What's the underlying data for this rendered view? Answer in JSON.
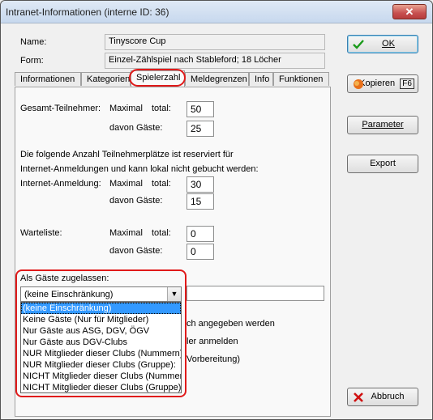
{
  "window": {
    "title": "Intranet-Informationen (interne ID: 36)",
    "close_symbol": "✕"
  },
  "header": {
    "name_label": "Name:",
    "name_value": "Tinyscore Cup",
    "form_label": "Form:",
    "form_value": "Einzel-Zählspiel nach Stableford; 18 Löcher"
  },
  "tabs": [
    {
      "label": "Informationen"
    },
    {
      "label": "Kategorien"
    },
    {
      "label": "Spielerzahl",
      "active": true
    },
    {
      "label": "Meldegrenzen"
    },
    {
      "label": "Info"
    },
    {
      "label": "Funktionen"
    }
  ],
  "panel": {
    "gesamt_label": "Gesamt-Teilnehmer:",
    "maximal": "Maximal",
    "total": "total:",
    "davon_gaeste": "davon Gäste:",
    "gesamt_total": "50",
    "gesamt_gaeste": "25",
    "info_line1": "Die folgende Anzahl Teilnehmerplätze ist reserviert für",
    "info_line2": "Internet-Anmeldungen und kann lokal nicht gebucht werden:",
    "internet_label": "Internet-Anmeldung:",
    "internet_total": "30",
    "internet_gaeste": "15",
    "warteliste_label": "Warteliste:",
    "warteliste_total": "0",
    "warteliste_gaeste": "0",
    "gaeste_label": "Als Gäste zugelassen:",
    "combo_value": "(keine Einschränkung)",
    "textbox_value": "",
    "obscured_1": "ch angegeben werden",
    "obscured_2": "ler anmelden",
    "obscured_3": "Vorbereitung)"
  },
  "dropdown_options": [
    "(keine Einschränkung)",
    "Keine Gäste (Nur für Mitglieder)",
    "Nur Gäste aus ASG, DGV, ÖGV",
    "Nur Gäste aus DGV-Clubs",
    "NUR Mitglieder dieser Clubs (Nummern):",
    "NUR Mitglieder dieser Clubs (Gruppe):",
    "NICHT Mitglieder dieser Clubs (Nummern)",
    "NICHT Mitglieder dieser Clubs (Gruppe):"
  ],
  "buttons": {
    "ok": "OK",
    "kopieren": "Kopieren",
    "kopieren_key": "F6",
    "parameter": "Parameter",
    "export": "Export",
    "abbruch": "Abbruch"
  },
  "icons": {
    "ok": "checkmark-icon",
    "kopieren": "copy-icon",
    "abbruch": "x-cancel-icon",
    "dropdown": "chevron-down-icon"
  },
  "colors": {
    "highlight": "#e01a1a",
    "selection": "#3399ff",
    "check_green": "#1a9a1a"
  }
}
